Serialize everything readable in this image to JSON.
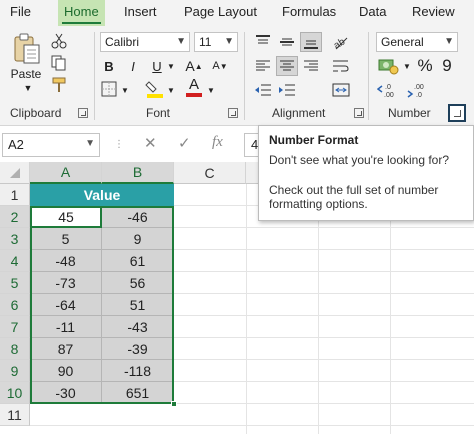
{
  "menu": {
    "items": [
      {
        "label": "File"
      },
      {
        "label": "Home"
      },
      {
        "label": "Insert"
      },
      {
        "label": "Page Layout"
      },
      {
        "label": "Formulas"
      },
      {
        "label": "Data"
      },
      {
        "label": "Review"
      }
    ],
    "active": "Home"
  },
  "ribbon": {
    "clipboard": {
      "paste_label": "Paste",
      "group_label": "Clipboard"
    },
    "font": {
      "font_name": "Calibri",
      "font_size": "11",
      "bold": "B",
      "italic": "I",
      "underline": "U",
      "font_color_letter": "A",
      "group_label": "Font"
    },
    "alignment": {
      "group_label": "Alignment"
    },
    "number": {
      "format": "General",
      "percent": "%",
      "comma": "9",
      "group_label": "Number"
    }
  },
  "formula_bar": {
    "name_box": "A2",
    "cancel_icon": "✕",
    "enter_icon": "✓",
    "fx_label": "fx",
    "value": "4"
  },
  "tooltip": {
    "title": "Number Format",
    "line1": "Don't see what you're looking for?",
    "line2": "Check out the full set of number formatting options."
  },
  "sheet": {
    "columns": [
      "A",
      "B",
      "C"
    ],
    "rows": [
      "1",
      "2",
      "3",
      "4",
      "5",
      "6",
      "7",
      "8",
      "9",
      "10",
      "11"
    ],
    "header_cell": "Value",
    "a_values": [
      "45",
      "5",
      "-48",
      "-73",
      "-64",
      "-11",
      "87",
      "90",
      "-30"
    ],
    "b_values": [
      "-46",
      "9",
      "61",
      "56",
      "51",
      "-43",
      "-39",
      "-118",
      "651"
    ],
    "active_cell": "A2"
  },
  "colors": {
    "accent_green": "#1e7b3a",
    "header_teal": "#2aa0a6",
    "selection_gray": "#d4d4d4",
    "font_color_red": "#d11f1f",
    "highlight_yellow": "#ffe100"
  }
}
